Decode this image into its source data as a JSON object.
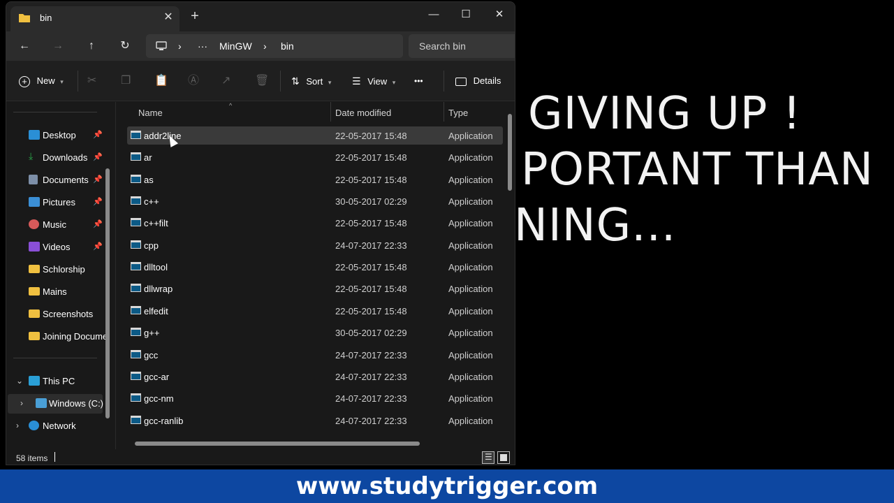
{
  "window": {
    "tab_title": "bin",
    "new_tab": "+",
    "tab_close": "✕"
  },
  "controls": {
    "minimize": "—",
    "maximize": "☐",
    "close": "✕"
  },
  "nav": {
    "back": "←",
    "forward": "→",
    "up": "↑",
    "refresh": "↻",
    "breadcrumb": [
      "MinGW",
      "bin"
    ],
    "ellipsis": "···",
    "sep": "›",
    "search_placeholder": "Search bin"
  },
  "commands": {
    "new_label": "New",
    "sort_label": "Sort",
    "view_label": "View",
    "more_label": "•••",
    "details_label": "Details"
  },
  "sidebar": {
    "quick": [
      {
        "label": "Desktop",
        "icon": "desktop-icon",
        "color": "#2a8fd6"
      },
      {
        "label": "Downloads",
        "icon": "download-icon",
        "color": "#2aa84a"
      },
      {
        "label": "Documents",
        "icon": "documents-icon",
        "color": "#7d8fa8"
      },
      {
        "label": "Pictures",
        "icon": "pictures-icon",
        "color": "#3b8fd6"
      },
      {
        "label": "Music",
        "icon": "music-icon",
        "color": "#d65a5a"
      },
      {
        "label": "Videos",
        "icon": "videos-icon",
        "color": "#8a4fd6"
      }
    ],
    "folders": [
      "Schlorship",
      "Mains",
      "Screenshots",
      "Joining Docume"
    ],
    "this_pc": "This PC",
    "drive": "Windows (C:)",
    "network": "Network"
  },
  "columns": {
    "name": "Name",
    "date": "Date modified",
    "type": "Type"
  },
  "files": [
    {
      "name": "addr2line",
      "date": "22-05-2017 15:48",
      "type": "Application"
    },
    {
      "name": "ar",
      "date": "22-05-2017 15:48",
      "type": "Application"
    },
    {
      "name": "as",
      "date": "22-05-2017 15:48",
      "type": "Application"
    },
    {
      "name": "c++",
      "date": "30-05-2017 02:29",
      "type": "Application"
    },
    {
      "name": "c++filt",
      "date": "22-05-2017 15:48",
      "type": "Application"
    },
    {
      "name": "cpp",
      "date": "24-07-2017 22:33",
      "type": "Application"
    },
    {
      "name": "dlltool",
      "date": "22-05-2017 15:48",
      "type": "Application"
    },
    {
      "name": "dllwrap",
      "date": "22-05-2017 15:48",
      "type": "Application"
    },
    {
      "name": "elfedit",
      "date": "22-05-2017 15:48",
      "type": "Application"
    },
    {
      "name": "g++",
      "date": "30-05-2017 02:29",
      "type": "Application"
    },
    {
      "name": "gcc",
      "date": "24-07-2017 22:33",
      "type": "Application"
    },
    {
      "name": "gcc-ar",
      "date": "24-07-2017 22:33",
      "type": "Application"
    },
    {
      "name": "gcc-nm",
      "date": "24-07-2017 22:33",
      "type": "Application"
    },
    {
      "name": "gcc-ranlib",
      "date": "24-07-2017 22:33",
      "type": "Application"
    }
  ],
  "status": {
    "count": "58 items"
  },
  "background_text": [
    "GIVING UP !",
    "PORTANT THAN",
    "NING..."
  ],
  "banner": "www.studytrigger.com"
}
